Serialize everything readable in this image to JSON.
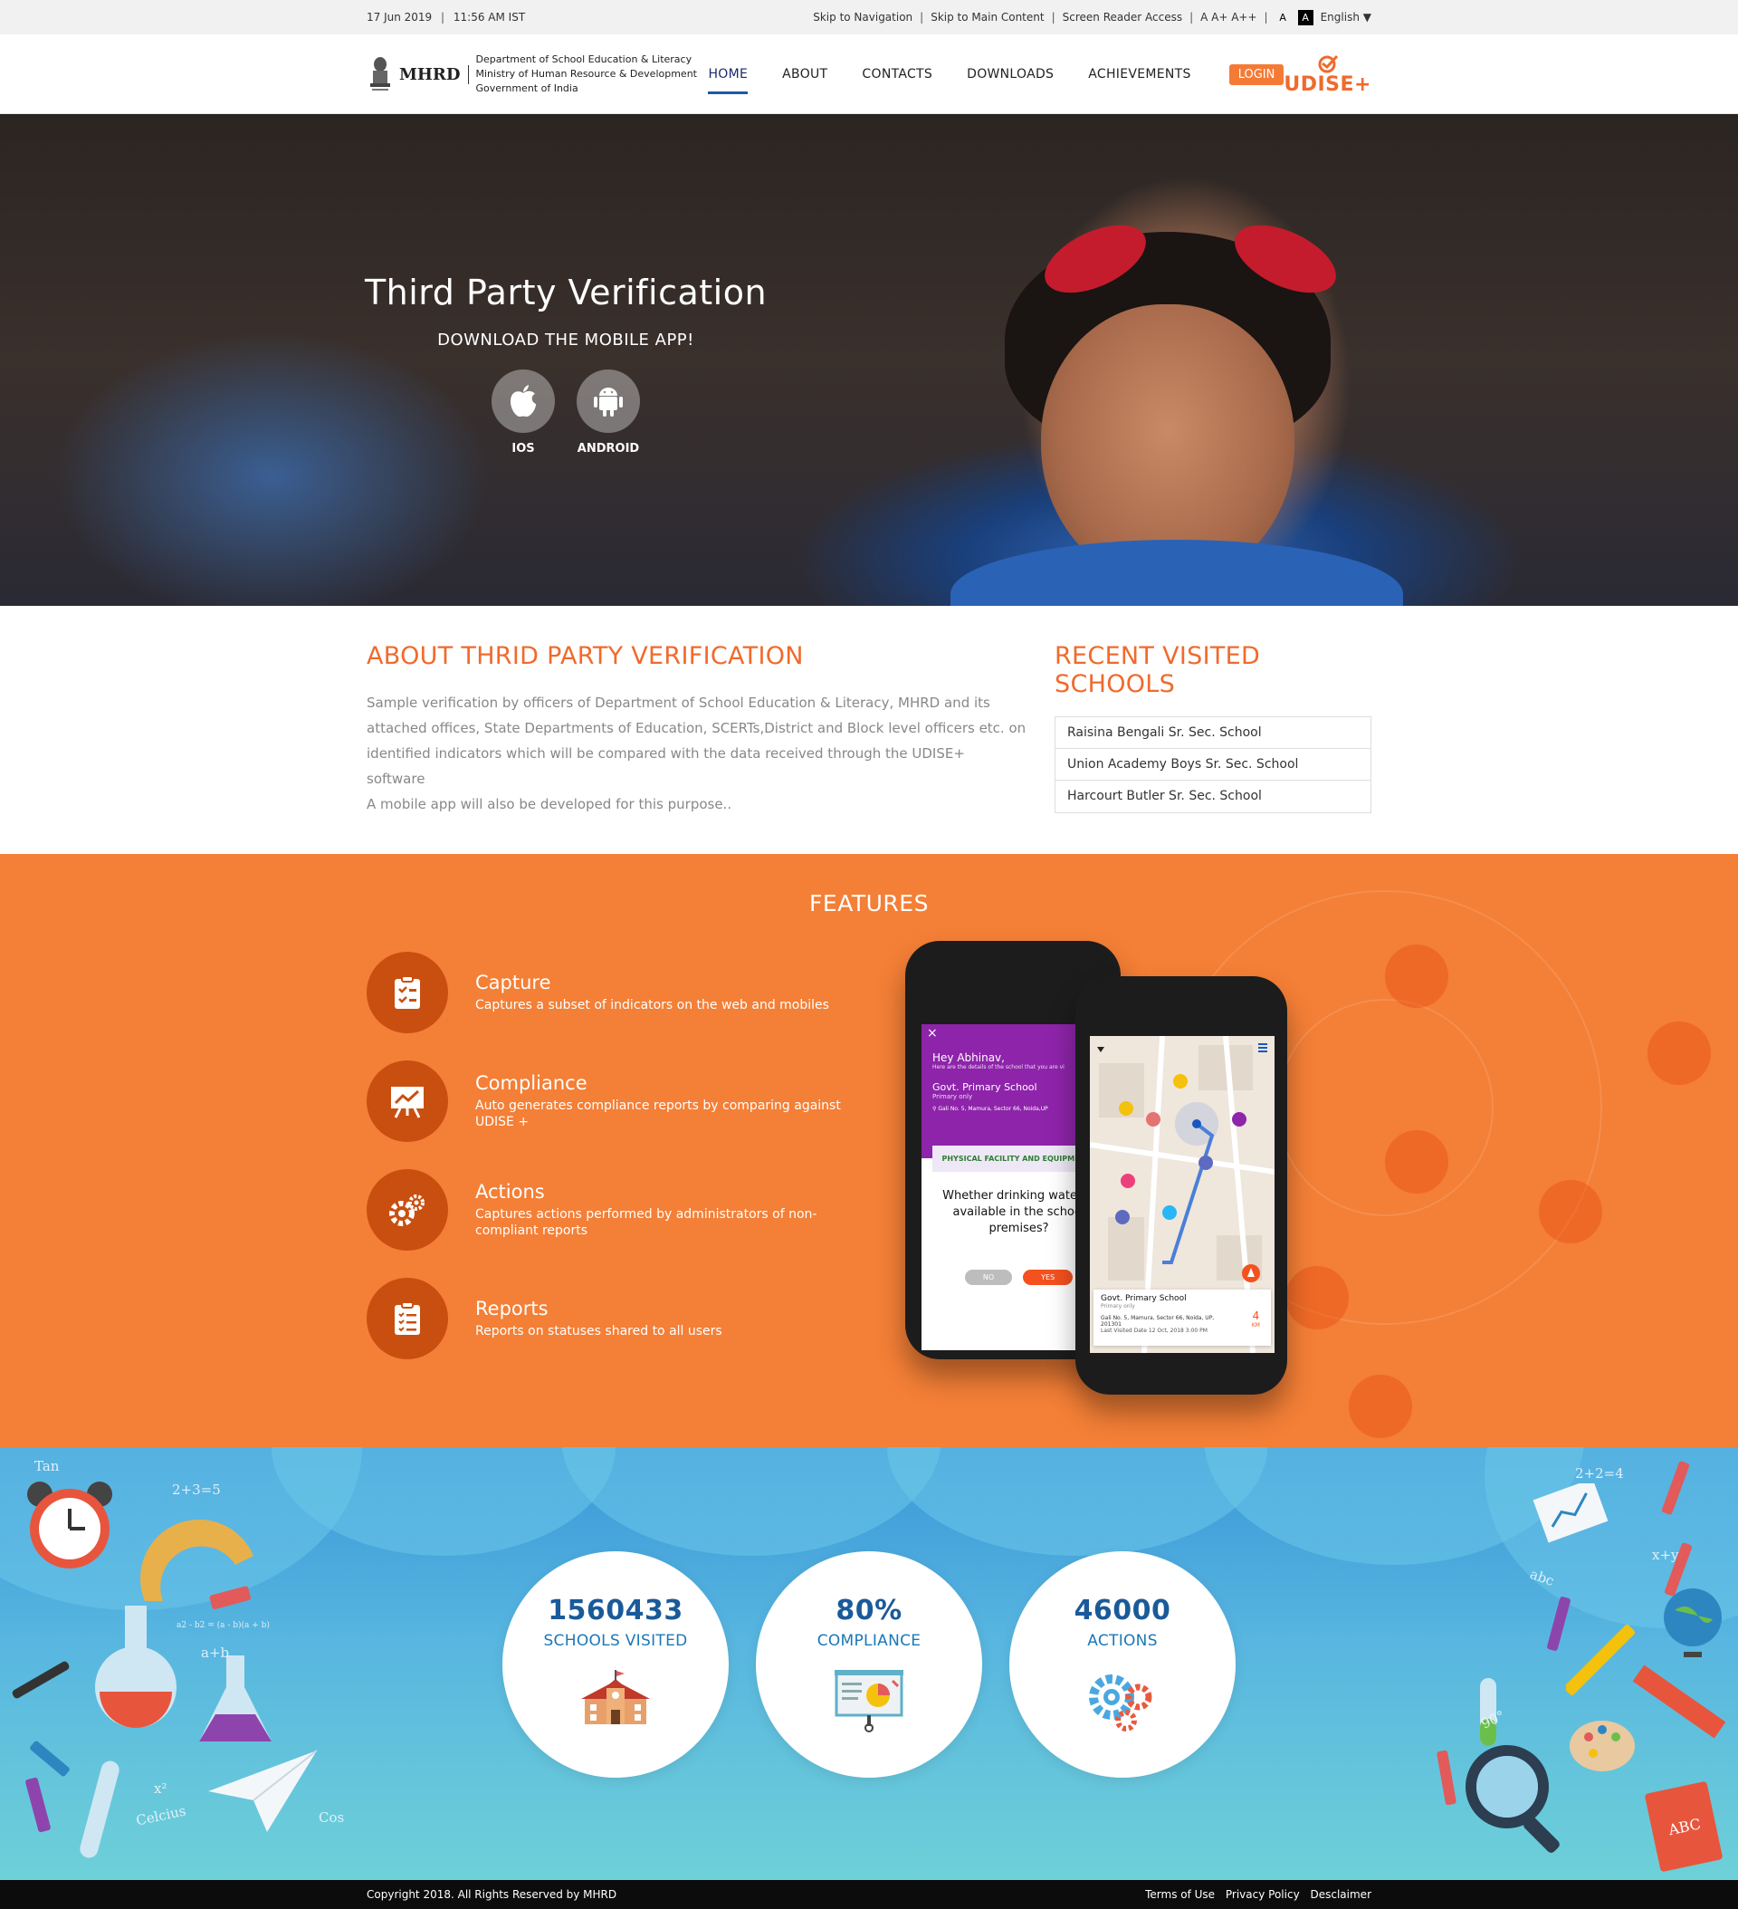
{
  "topbar": {
    "date": "17 Jun 2019",
    "time": "11:56 AM IST",
    "skip_nav": "Skip to Navigation",
    "skip_main": "Skip to Main Content",
    "screen_reader": "Screen Reader Access",
    "font_sizes": "A A+ A++",
    "contrast_light": "A",
    "contrast_dark": "A",
    "language": "English"
  },
  "header": {
    "brand_short": "MHRD",
    "brand_line1": "Department of School Education & Literacy",
    "brand_line2": "Ministry of Human Resource & Development",
    "brand_line3": "Government of India",
    "nav": [
      "HOME",
      "ABOUT",
      "CONTACTS",
      "DOWNLOADS",
      "ACHIEVEMENTS"
    ],
    "login": "LOGIN",
    "logo_text": "UDISE+"
  },
  "hero": {
    "title": "Third Party Verification",
    "subtitle": "DOWNLOAD THE MOBILE APP!",
    "ios_label": "IOS",
    "android_label": "ANDROID"
  },
  "about": {
    "title": "ABOUT THRID PARTY VERIFICATION",
    "paragraph": "Sample verification by officers of Department of School Education & Literacy, MHRD and its attached offices, State Departments of Education, SCERTs,District and Block level officers etc. on identified indicators which will be compared with the data received through the UDISE+ software",
    "note": "A mobile app will also be developed for this purpose.."
  },
  "recent": {
    "title": "RECENT VISITED SCHOOLS",
    "schools": [
      "Raisina Bengali Sr. Sec. School",
      "Union Academy Boys Sr. Sec. School",
      "Harcourt Butler Sr. Sec. School"
    ]
  },
  "features": {
    "title": "FEATURES",
    "items": [
      {
        "title": "Capture",
        "desc": "Captures a subset of indicators on the web and mobiles",
        "icon": "clipboard-check-icon"
      },
      {
        "title": "Compliance",
        "desc": "Auto generates compliance reports by comparing against UDISE +",
        "icon": "chart-board-icon"
      },
      {
        "title": "Actions",
        "desc": "Captures actions performed by administrators of non-compliant reports",
        "icon": "gears-icon"
      },
      {
        "title": "Reports",
        "desc": "Reports on statuses shared to all users",
        "icon": "clipboard-list-icon"
      }
    ],
    "phone1": {
      "greeting": "Hey Abhinav,",
      "greeting_sub": "Here are the details of the school that you are vi",
      "school": "Govt. Primary School",
      "school_sub": "Primary only",
      "address": "Gali No. 5, Mamura, Sector 66, Noida,UP",
      "section": "PHYSICAL FACILITY AND EQUIPMENTS",
      "question": "Whether drinking water is available in the school premises?",
      "no": "NO",
      "yes": "YES"
    },
    "phone2": {
      "card_title": "Govt. Primary School",
      "card_sub": "Primary only",
      "card_address": "Gali No. 5, Mamura, Sector 66, Noida, UP, 201301",
      "card_visited": "Last Visited Date 12 Oct, 2018 3:00 PM",
      "distance": "4",
      "distance_unit": "KM"
    }
  },
  "stats": [
    {
      "value": "1560433",
      "label": "SCHOOLS VISITED",
      "icon": "school-building-icon"
    },
    {
      "value": "80%",
      "label": "COMPLIANCE",
      "icon": "presentation-chart-icon"
    },
    {
      "value": "46000",
      "label": "ACTIONS",
      "icon": "gears-icon"
    }
  ],
  "doodles": {
    "left": [
      "Tan",
      "2+3=5",
      "a+b",
      "x²",
      "Celcius",
      "Cos",
      "a2 - b2 = (a - b)(a + b)"
    ],
    "right": [
      "2+2=4",
      "abc",
      "x+y",
      "90°",
      "ABC"
    ]
  },
  "footer": {
    "copyright": "Copyright 2018. All Rights Reserved by MHRD",
    "links": [
      "Terms of Use",
      "Privacy Policy",
      "Desclaimer"
    ]
  }
}
